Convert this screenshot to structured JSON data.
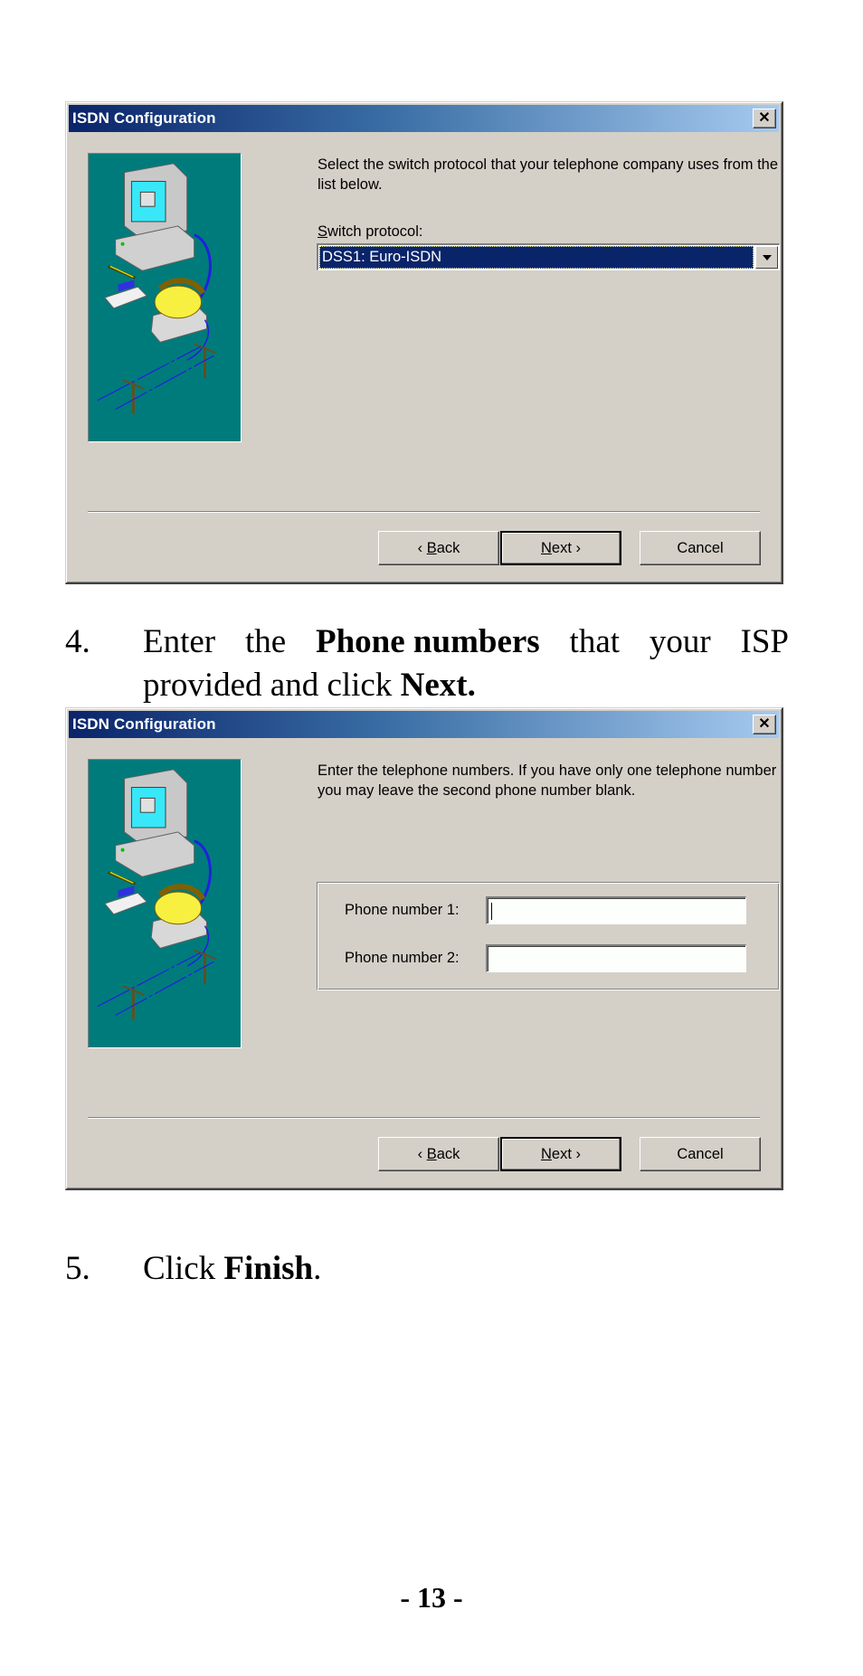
{
  "dialogs": [
    {
      "title": "ISDN Configuration",
      "close_icon": "close-icon",
      "illustration": "computer-phone-telephone-lines-illustration",
      "description": "Select the switch protocol that your telephone company uses from the list below.",
      "field_label_accesskey": "S",
      "field_label_rest": "witch protocol:",
      "switch_protocol": {
        "selected": "DSS1: Euro-ISDN",
        "dropdown_icon": "chevron-down-icon"
      },
      "buttons": {
        "back_prefix": "‹ ",
        "back_key": "B",
        "back_rest": "ack",
        "next_key": "N",
        "next_rest": "ext ›",
        "cancel": "Cancel"
      }
    },
    {
      "title": "ISDN Configuration",
      "close_icon": "close-icon",
      "illustration": "computer-phone-telephone-lines-illustration",
      "description": "Enter the telephone numbers.  If you have only one telephone number you may leave the second phone number blank.",
      "phone1_label": "Phone number 1:",
      "phone1_value": "",
      "phone2_label": "Phone number 2:",
      "phone2_value": "",
      "buttons": {
        "back_prefix": "‹ ",
        "back_key": "B",
        "back_rest": "ack",
        "next_key": "N",
        "next_rest": "ext ›",
        "cancel": "Cancel"
      }
    }
  ],
  "steps": [
    {
      "number": "4.",
      "w1": "Enter",
      "w2": "the",
      "bold1": "Phone numbers",
      "w3": "that",
      "w4": "your",
      "w5": "ISP",
      "line2_pre": "provided and click ",
      "bold2": "Next."
    },
    {
      "number": "5.",
      "pre": "Click ",
      "bold": "Finish",
      "post": "."
    }
  ],
  "page_number": "- 13 -"
}
